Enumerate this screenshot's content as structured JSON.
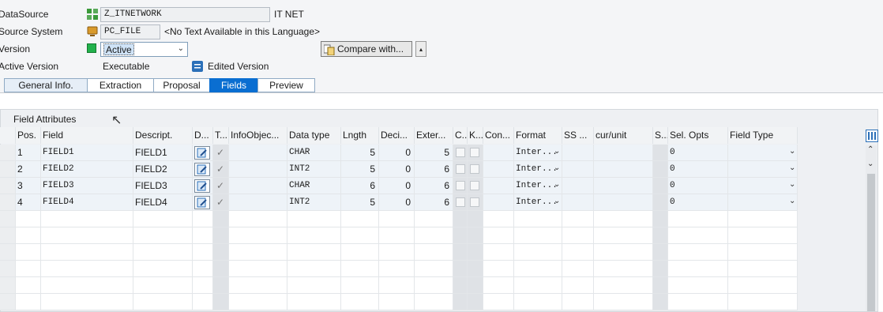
{
  "header": {
    "datasource_label": "DataSource",
    "datasource_value": "Z_ITNETWORK",
    "datasource_text": "IT NET",
    "source_system_label": "Source System",
    "source_system_value": "PC_FILE",
    "source_system_text": "<No Text Available in this Language>",
    "version_label": "Version",
    "version_value": "Active",
    "compare_button": "Compare with...",
    "active_version_label": "Active Version",
    "active_version_value": "Executable",
    "edited_version_text": "Edited Version"
  },
  "tabs": [
    "General Info.",
    "Extraction",
    "Proposal",
    "Fields",
    "Preview"
  ],
  "active_tab": "Fields",
  "group_title": "Field Attributes",
  "columns": [
    "Pos.",
    "Field",
    "Descript.",
    "D...",
    "T...",
    "InfoObjec...",
    "Data type",
    "Lngth",
    "Deci...",
    "Exter...",
    "C...",
    "K...",
    "Con...",
    "Format",
    "SS ...",
    "cur/unit",
    "S...",
    "Sel. Opts",
    "Field Type"
  ],
  "rows": [
    {
      "pos": "1",
      "field": "FIELD1",
      "desc": "FIELD1",
      "dtype": "CHAR",
      "length": "5",
      "dec": "0",
      "ext": "5",
      "format": "Inter...",
      "selopts": "0"
    },
    {
      "pos": "2",
      "field": "FIELD2",
      "desc": "FIELD2",
      "dtype": "INT2",
      "length": "5",
      "dec": "0",
      "ext": "6",
      "format": "Inter...",
      "selopts": "0"
    },
    {
      "pos": "3",
      "field": "FIELD3",
      "desc": "FIELD3",
      "dtype": "CHAR",
      "length": "6",
      "dec": "0",
      "ext": "6",
      "format": "Inter...",
      "selopts": "0"
    },
    {
      "pos": "4",
      "field": "FIELD4",
      "desc": "FIELD4",
      "dtype": "INT2",
      "length": "5",
      "dec": "0",
      "ext": "6",
      "format": "Inter...",
      "selopts": "0"
    }
  ],
  "colors": {
    "accent": "#0a6ed1",
    "active_status": "#22b14c",
    "row_bg": "#eef3f8"
  },
  "icons": {
    "datasource": "datasource-icon",
    "source_system": "pc-file-icon",
    "version": "green-status-icon",
    "compare": "compare-icon",
    "edited": "edited-version-icon",
    "detail": "edit-detail-icon",
    "layout": "column-layout-icon"
  }
}
